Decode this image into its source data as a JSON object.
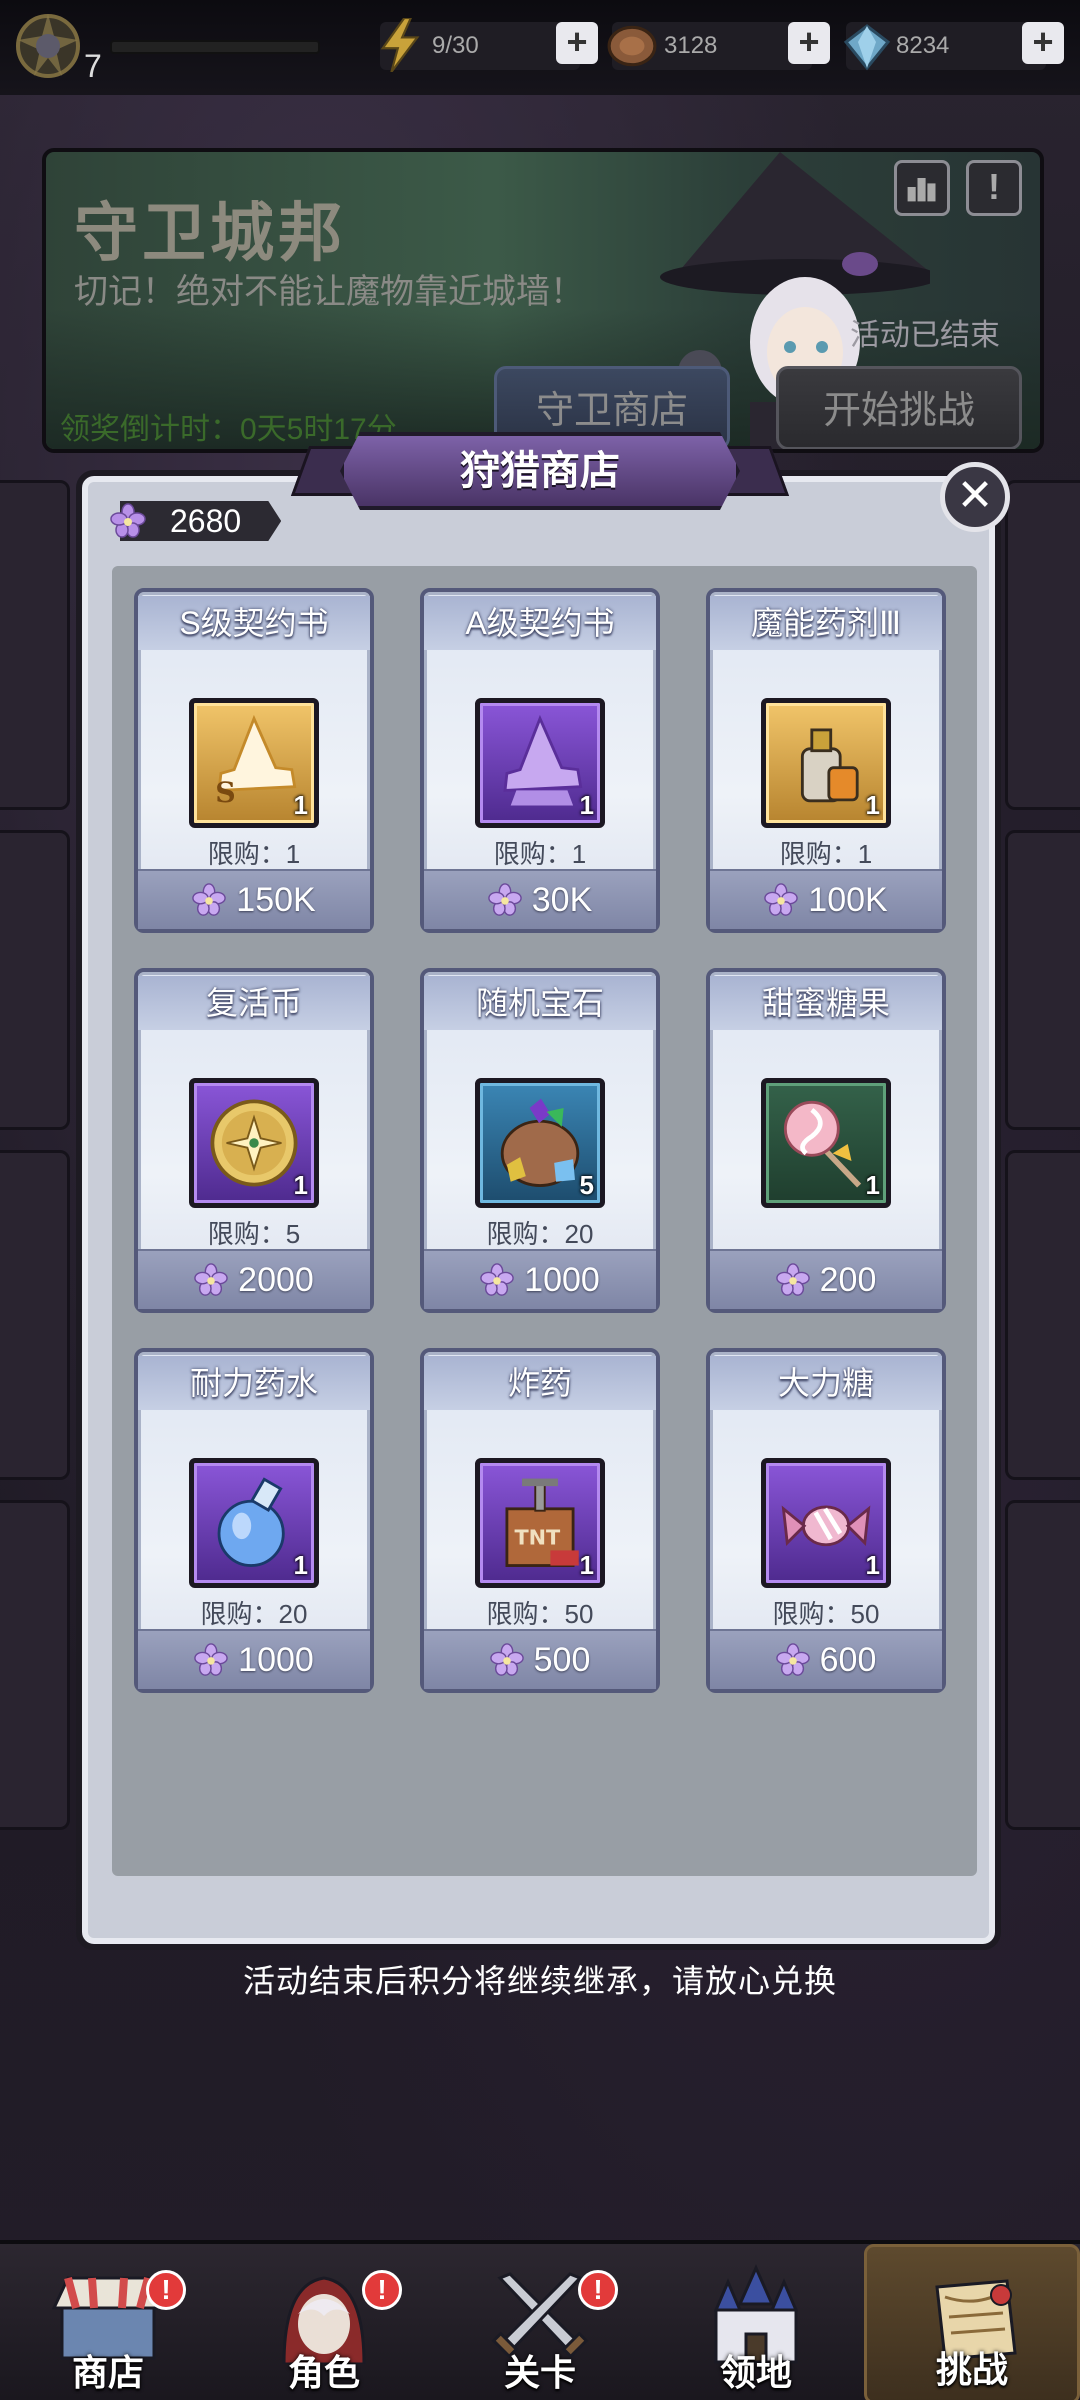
{
  "topbar": {
    "level": "7",
    "energy": "9/30",
    "coins": "3128",
    "gems": "8234"
  },
  "banner": {
    "title": "守卫城邦",
    "subtitle": "切记！绝对不能让魔物靠近城墙！",
    "countdown": "领奖倒计时：0天5时17分",
    "status": "活动已结束",
    "shop_button": "守卫商店",
    "challenge_button": "开始挑战"
  },
  "modal": {
    "title": "狩猎商店",
    "points": "2680",
    "close_symbol": "✕",
    "items": [
      {
        "name": "S级契约书",
        "qty": "1",
        "limit": "限购：1",
        "price": "150K",
        "icon": "s-contract-hat-icon",
        "frame": "gold"
      },
      {
        "name": "A级契约书",
        "qty": "1",
        "limit": "限购：1",
        "price": "30K",
        "icon": "a-contract-hat-icon",
        "frame": "purple"
      },
      {
        "name": "魔能药剂Ⅲ",
        "qty": "1",
        "limit": "限购：1",
        "price": "100K",
        "icon": "magic-potion-icon",
        "frame": "gold"
      },
      {
        "name": "复活币",
        "qty": "1",
        "limit": "限购：5",
        "price": "2000",
        "icon": "revive-coin-icon",
        "frame": "purple"
      },
      {
        "name": "随机宝石",
        "qty": "5",
        "limit": "限购：20",
        "price": "1000",
        "icon": "gem-bag-icon",
        "frame": "blue"
      },
      {
        "name": "甜蜜糖果",
        "qty": "1",
        "limit": "",
        "price": "200",
        "icon": "lollipop-icon",
        "frame": "green"
      },
      {
        "name": "耐力药水",
        "qty": "1",
        "limit": "限购：20",
        "price": "1000",
        "icon": "stamina-potion-icon",
        "frame": "purple"
      },
      {
        "name": "炸药",
        "qty": "1",
        "limit": "限购：50",
        "price": "500",
        "icon": "tnt-icon",
        "frame": "purple"
      },
      {
        "name": "大力糖",
        "qty": "1",
        "limit": "限购：50",
        "price": "600",
        "icon": "candy-icon",
        "frame": "purple"
      }
    ]
  },
  "footer_note": "活动结束后积分将继续继承，请放心兑换",
  "nav": {
    "items": [
      {
        "label": "商店",
        "badge": "!"
      },
      {
        "label": "角色",
        "badge": "!"
      },
      {
        "label": "关卡",
        "badge": "!"
      },
      {
        "label": "领地",
        "badge": ""
      },
      {
        "label": "挑战",
        "badge": ""
      }
    ]
  },
  "colors": {
    "currency_flower": "#b890e8",
    "card_border": "#54597a",
    "modal_title": "#5e4583",
    "badge_red": "#e23a3a"
  }
}
